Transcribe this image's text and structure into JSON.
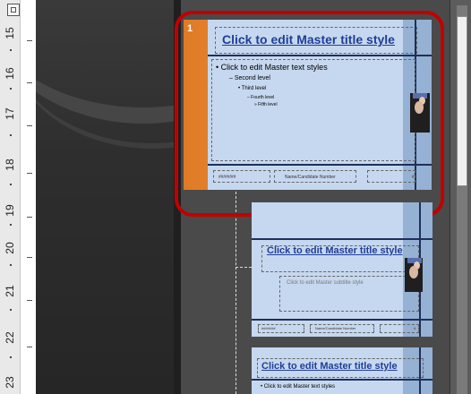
{
  "ruler": {
    "numbers": [
      "15",
      "16",
      "17",
      "18",
      "19",
      "20",
      "21",
      "22",
      "23"
    ]
  },
  "master_slide": {
    "number": "1",
    "title": "Click to edit Master title style",
    "body": [
      "Click to edit Master text styles",
      "Second level",
      "Third level",
      "Fourth level",
      "Fifth level"
    ],
    "footer_date": "##/##/##",
    "footer_text": "Name/Candidate Number",
    "footer_page": "#"
  },
  "layout_title_slide": {
    "title": "Click to edit Master title style",
    "subtitle": "Click to edit Master subtitle style",
    "footer_date": "##/##/##",
    "footer_text": "Name/Candidate Number",
    "footer_page": "#"
  },
  "layout_title_content": {
    "title": "Click to edit Master title style",
    "body_first": "Click to edit Master text styles"
  },
  "colors": {
    "selection_outline": "#c00000",
    "slide_background": "#c6d8ef",
    "title_text": "#1f3e99",
    "master_accent": "#e07a24"
  }
}
